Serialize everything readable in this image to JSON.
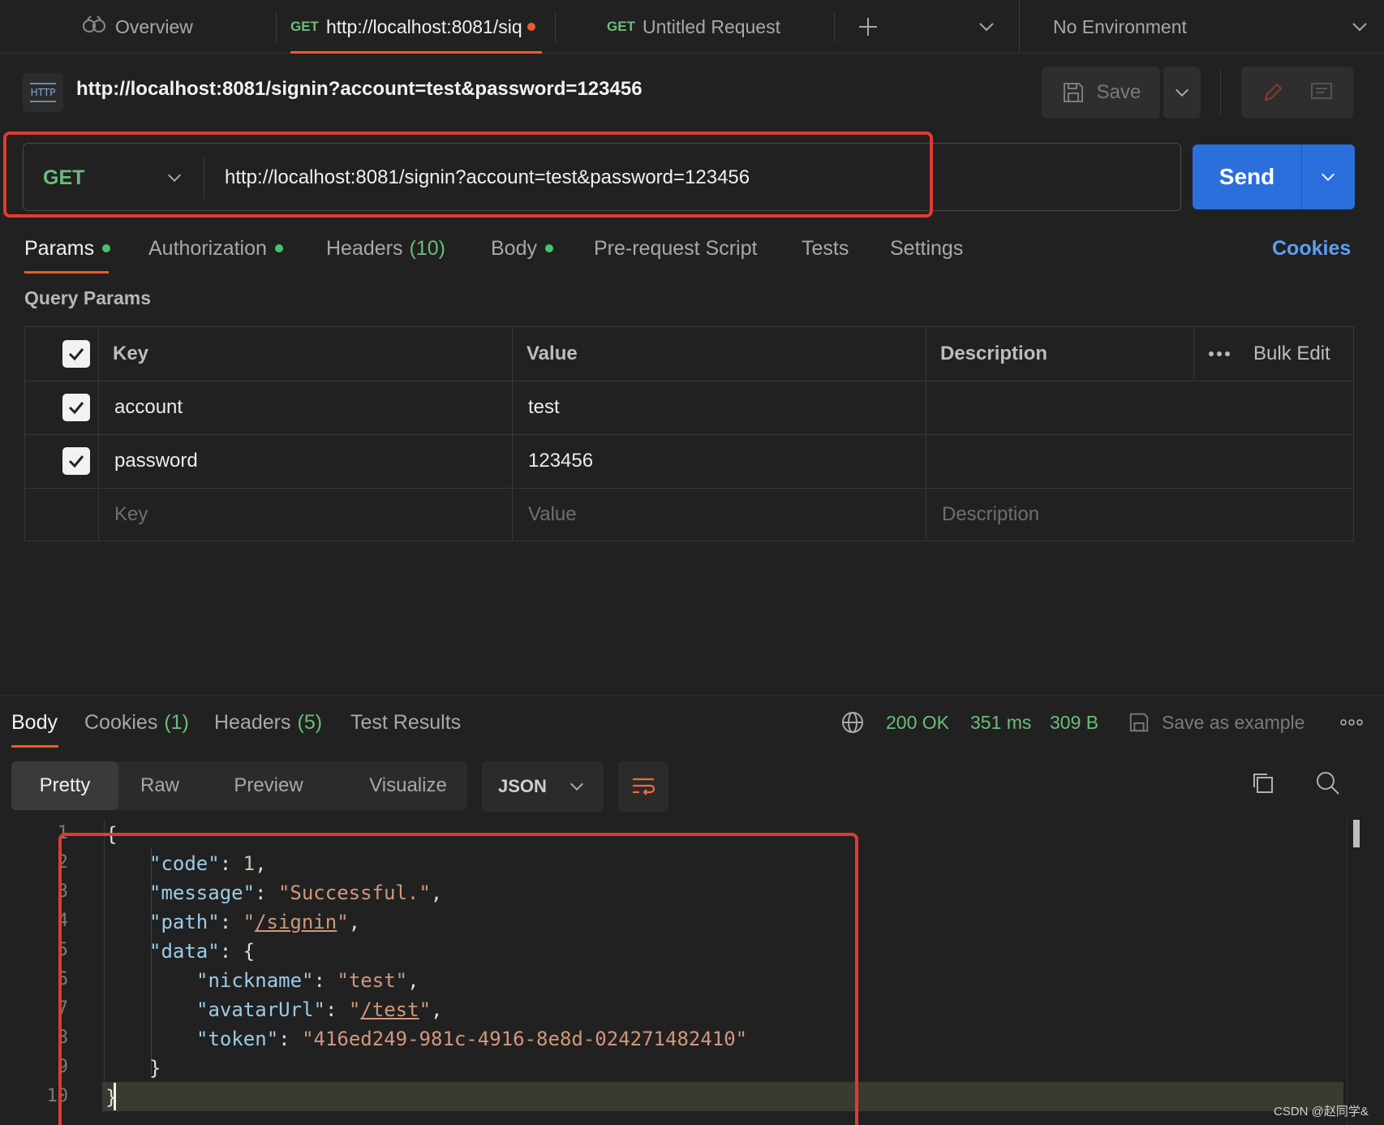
{
  "tabs": [
    {
      "label": "Overview"
    },
    {
      "method": "GET",
      "label": "http://localhost:8081/siq"
    },
    {
      "method": "GET",
      "label": "Untitled Request"
    }
  ],
  "environment": "No Environment",
  "request": {
    "title": "http://localhost:8081/signin?account=test&password=123456",
    "method": "GET",
    "url": "http://localhost:8081/signin?account=test&password=123456",
    "save_label": "Save",
    "send_label": "Send",
    "http_badge": "HTTP"
  },
  "request_tabs": {
    "params": "Params",
    "authorization": "Authorization",
    "headers": "Headers",
    "headers_count": "(10)",
    "body": "Body",
    "prerequest": "Pre-request Script",
    "tests": "Tests",
    "settings": "Settings",
    "cookies": "Cookies"
  },
  "query_params": {
    "title": "Query Params",
    "headers": {
      "key": "Key",
      "value": "Value",
      "description": "Description",
      "bulk_edit": "Bulk Edit"
    },
    "rows": [
      {
        "key": "account",
        "value": "test"
      },
      {
        "key": "password",
        "value": "123456"
      }
    ],
    "placeholders": {
      "key": "Key",
      "value": "Value",
      "description": "Description"
    }
  },
  "response": {
    "tabs": {
      "body": "Body",
      "cookies": "Cookies",
      "cookies_count": "(1)",
      "headers": "Headers",
      "headers_count": "(5)",
      "test_results": "Test Results"
    },
    "status": "200 OK",
    "time": "351 ms",
    "size": "309 B",
    "save_example": "Save as example",
    "views": {
      "pretty": "Pretty",
      "raw": "Raw",
      "preview": "Preview",
      "visualize": "Visualize"
    },
    "format": "JSON",
    "line_numbers": [
      "1",
      "2",
      "3",
      "4",
      "5",
      "6",
      "7",
      "8",
      "9",
      "10"
    ],
    "json": {
      "code_key": "\"code\"",
      "code_val": "1",
      "message_key": "\"message\"",
      "message_val": "\"Successful.\"",
      "path_key": "\"path\"",
      "path_val": "/signin",
      "data_key": "\"data\"",
      "nickname_key": "\"nickname\"",
      "nickname_val": "\"test\"",
      "avatar_key": "\"avatarUrl\"",
      "avatar_val": "/test",
      "token_key": "\"token\"",
      "token_val": "\"416ed249-981c-4916-8e8d-024271482410\""
    }
  },
  "watermark": "CSDN @赵同学&",
  "colors": {
    "accent": "#2a6fdb",
    "get_method": "#6bbd7b",
    "highlight_box": "#e03c2e",
    "active_tab": "#ef5b25"
  }
}
